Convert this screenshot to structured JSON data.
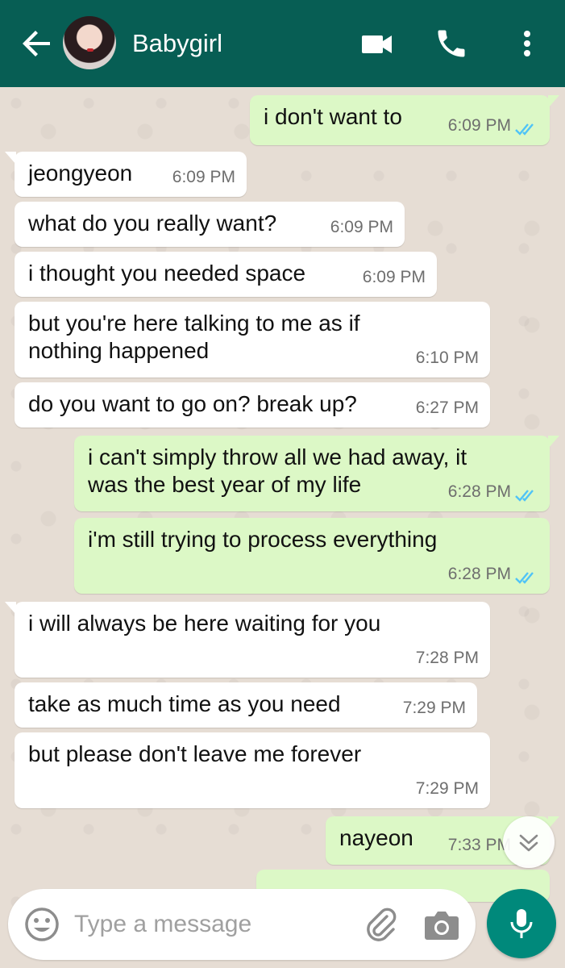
{
  "header": {
    "contact_name": "Babygirl",
    "icons": [
      "back-arrow-icon",
      "videocam-icon",
      "phone-icon",
      "more-vert-icon"
    ],
    "color": "#075e54"
  },
  "messages": [
    {
      "dir": "out",
      "text": "i don't want to",
      "time": "6:09 PM",
      "read": true
    },
    {
      "dir": "in",
      "text": "jeongyeon",
      "time": "6:09 PM"
    },
    {
      "dir": "in",
      "text": "what do you really want?",
      "time": "6:09 PM"
    },
    {
      "dir": "in",
      "text": "i thought you needed space",
      "time": "6:09 PM"
    },
    {
      "dir": "in",
      "text": "but you're here talking to me as if\nnothing happened",
      "time": "6:10 PM"
    },
    {
      "dir": "in",
      "text": "do you want to go on? break up?",
      "time": "6:27 PM"
    },
    {
      "dir": "out",
      "text": "i can't simply throw all we had away, it\nwas the best year of my life",
      "time": "6:28 PM",
      "read": true
    },
    {
      "dir": "out",
      "text": "i'm still trying to process everything",
      "time": "6:28 PM",
      "read": true
    },
    {
      "dir": "in",
      "text": "i will always be here waiting for you",
      "time": "7:28 PM"
    },
    {
      "dir": "in",
      "text": "take as much time as you need",
      "time": "7:29 PM"
    },
    {
      "dir": "in",
      "text": "but please don't leave me forever",
      "time": "7:29 PM"
    },
    {
      "dir": "out",
      "text": "nayeon",
      "time": "7:33 PM",
      "read": false
    }
  ],
  "composer": {
    "placeholder": "Type a message",
    "icons": [
      "emoji-icon",
      "paperclip-icon",
      "camera-icon",
      "mic-icon"
    ]
  },
  "colors": {
    "outgoing_bubble": "#dcf8c6",
    "incoming_bubble": "#ffffff",
    "read_ticks": "#4fc3f7",
    "mic_button": "#00897b"
  }
}
